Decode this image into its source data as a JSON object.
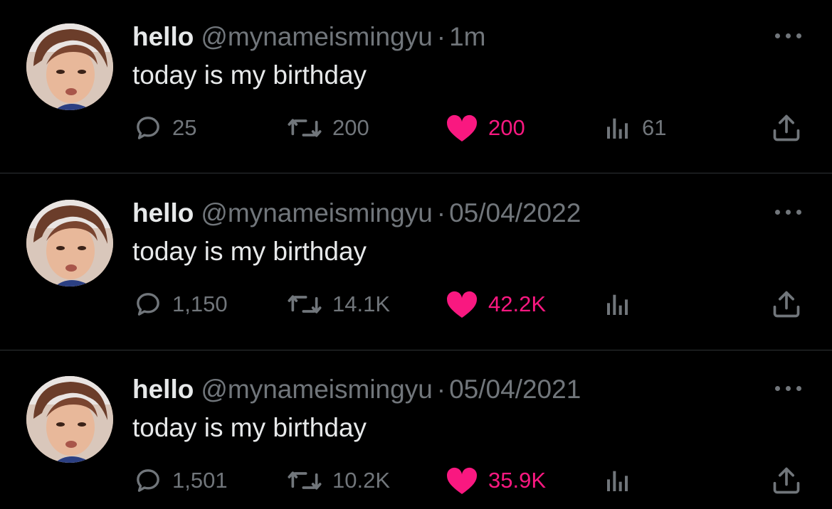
{
  "colors": {
    "background": "#000000",
    "primary_text": "#e7e9ea",
    "secondary_text": "#71767b",
    "like_active": "#f91880",
    "divider": "#2f3336"
  },
  "icons": {
    "more": "more-horizontal-icon",
    "reply": "reply-bubble-icon",
    "retweet": "retweet-icon",
    "like": "heart-filled-icon",
    "views": "views-bar-chart-icon",
    "share": "share-upload-icon"
  },
  "tweets": [
    {
      "display_name": "hello",
      "handle": "@mynameismingyu",
      "separator": "·",
      "time": "1m",
      "text": "today is my birthday",
      "replies": "25",
      "retweets": "200",
      "likes": "200",
      "views": "61"
    },
    {
      "display_name": "hello",
      "handle": "@mynameismingyu",
      "separator": "·",
      "time": "05/04/2022",
      "text": "today is my birthday",
      "replies": "1,150",
      "retweets": "14.1K",
      "likes": "42.2K",
      "views": ""
    },
    {
      "display_name": "hello",
      "handle": "@mynameismingyu",
      "separator": "·",
      "time": "05/04/2021",
      "text": "today is my birthday",
      "replies": "1,501",
      "retweets": "10.2K",
      "likes": "35.9K",
      "views": ""
    }
  ]
}
